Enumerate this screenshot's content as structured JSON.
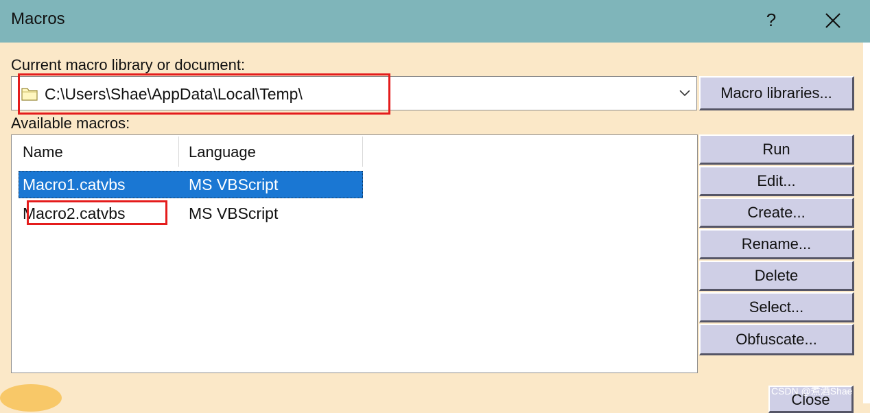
{
  "window": {
    "title": "Macros",
    "help_label": "?"
  },
  "library": {
    "label": "Current macro library or document:",
    "path": "C:\\Users\\Shae\\AppData\\Local\\Temp\\",
    "libraries_button": "Macro libraries..."
  },
  "macros": {
    "label": "Available macros:",
    "columns": [
      "Name",
      "Language"
    ],
    "rows": [
      {
        "name": "Macro1.catvbs",
        "language": "MS VBScript",
        "selected": true
      },
      {
        "name": "Macro2.catvbs",
        "language": "MS VBScript",
        "selected": false
      }
    ]
  },
  "actions": [
    "Run",
    "Edit...",
    "Create...",
    "Rename...",
    "Delete",
    "Select...",
    "Obfuscate..."
  ],
  "close_label": "Close",
  "watermark": "CSDN @煮酒Shae",
  "colors": {
    "title_bar": "#7fb5ba",
    "dialog_background": "#fbe8c8",
    "button_face": "#cfcfe6",
    "selection": "#1a77d3",
    "annotation": "#e41c1c"
  }
}
